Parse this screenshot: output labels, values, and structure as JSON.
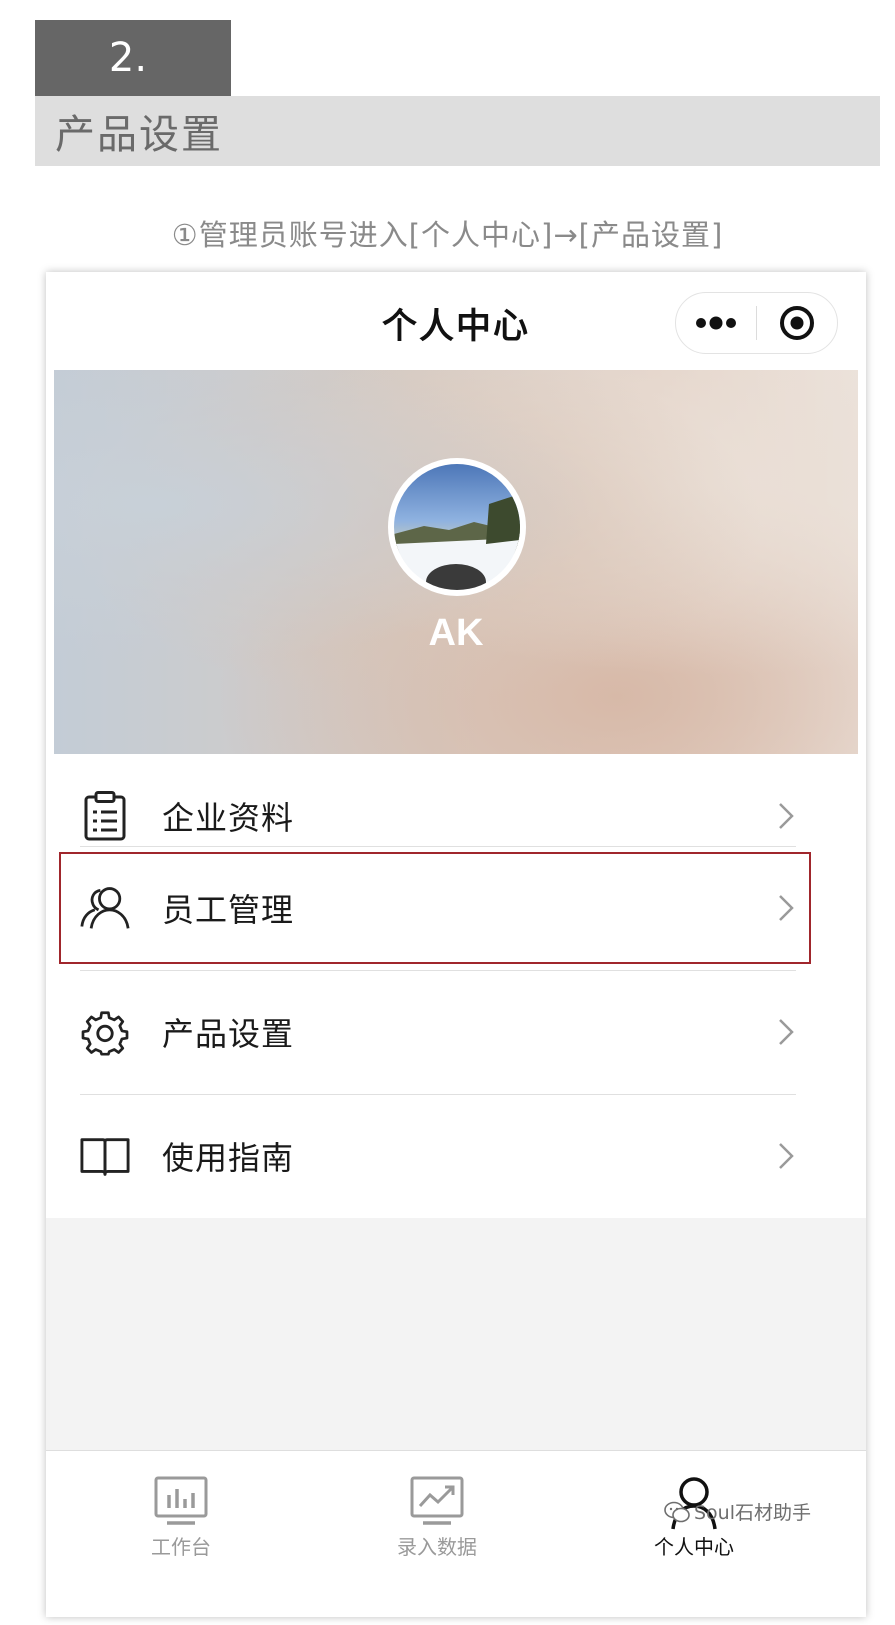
{
  "header": {
    "step_number": "2.",
    "section_title": "产品设置",
    "instruction": "①管理员账号进入[个人中心]→[产品设置]"
  },
  "screen": {
    "nav_title": "个人中心",
    "capsule": {
      "more_icon": "more-dots-icon",
      "close_icon": "target-circle-icon"
    },
    "profile": {
      "username": "AK"
    },
    "menu": [
      {
        "label": "企业资料",
        "icon": "clipboard-icon"
      },
      {
        "label": "员工管理",
        "icon": "users-icon"
      },
      {
        "label": "产品设置",
        "icon": "gear-icon"
      },
      {
        "label": "使用指南",
        "icon": "book-icon"
      }
    ],
    "tabbar": [
      {
        "label": "工作台",
        "icon": "bar-chart-icon",
        "active": false
      },
      {
        "label": "录入数据",
        "icon": "trend-chart-icon",
        "active": false
      },
      {
        "label": "个人中心",
        "icon": "person-icon",
        "active": true
      }
    ]
  },
  "watermark": {
    "text": "Soul石材助手",
    "icon": "wechat-icon"
  },
  "colors": {
    "highlight_border": "#a0262c",
    "badge_bg": "#666666",
    "section_bg": "#dedede"
  }
}
